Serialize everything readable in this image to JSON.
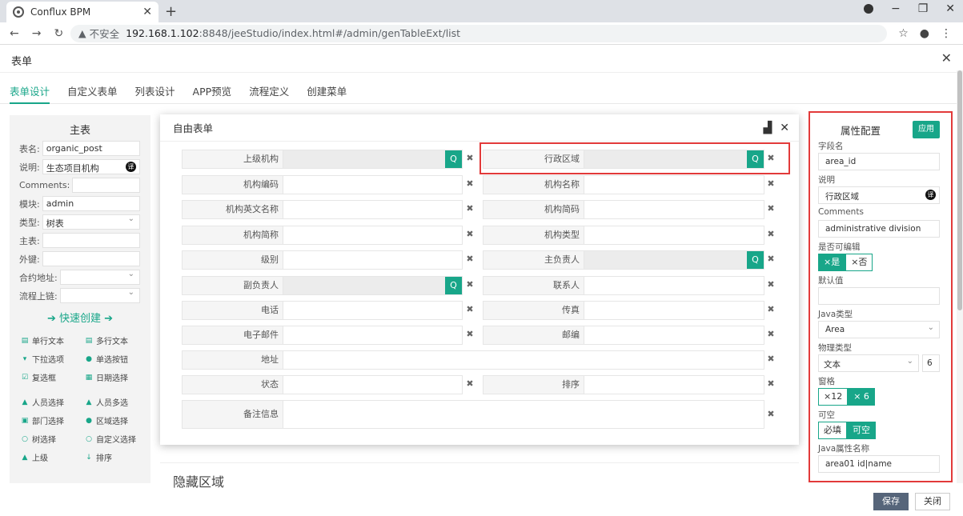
{
  "browser": {
    "tab_title": "Conflux BPM",
    "insecure_label": "不安全",
    "url_host": "192.168.1.102",
    "url_path": ":8848/jeeStudio/index.html#/admin/genTableExt/list"
  },
  "app": {
    "title": "表单",
    "tabs": [
      "表单设计",
      "自定义表单",
      "列表设计",
      "APP预览",
      "流程定义",
      "创建菜单"
    ]
  },
  "left_panel": {
    "title": "主表",
    "fields": [
      {
        "label": "表名:",
        "value": "organic_post"
      },
      {
        "label": "说明:",
        "value": "生态项目机构",
        "badge": "译"
      },
      {
        "label": "Comments:",
        "value": ""
      },
      {
        "label": "模块:",
        "value": "admin"
      },
      {
        "label": "类型:",
        "value": "树表",
        "select": true
      },
      {
        "label": "主表:",
        "value": ""
      },
      {
        "label": "外键:",
        "value": ""
      },
      {
        "label": "合约地址:",
        "value": "",
        "select": true
      },
      {
        "label": "流程上链:",
        "value": "",
        "select": true
      }
    ],
    "quick_create": "快速创建",
    "components": [
      {
        "icon": "▤",
        "name": "text-icon",
        "label": "单行文本"
      },
      {
        "icon": "▤",
        "name": "textarea-icon",
        "label": "多行文本"
      },
      {
        "icon": "▾",
        "name": "dropdown-icon",
        "label": "下拉选项"
      },
      {
        "icon": "●",
        "name": "radio-icon",
        "label": "单选按钮"
      },
      {
        "icon": "☑",
        "name": "checkbox-icon",
        "label": "复选框"
      },
      {
        "icon": "▦",
        "name": "calendar-icon",
        "label": "日期选择"
      },
      {
        "icon": "▲",
        "name": "user-icon",
        "label": "人员选择"
      },
      {
        "icon": "▲",
        "name": "users-icon",
        "label": "人员多选"
      },
      {
        "icon": "▣",
        "name": "sitemap-icon",
        "label": "部门选择"
      },
      {
        "icon": "●",
        "name": "map-pin-icon",
        "label": "区域选择"
      },
      {
        "icon": "○",
        "name": "search-icon",
        "label": "树选择"
      },
      {
        "icon": "○",
        "name": "search-icon",
        "label": "自定义选择"
      },
      {
        "icon": "▲",
        "name": "user-icon",
        "label": "上级"
      },
      {
        "icon": "↓",
        "name": "sort-icon",
        "label": "排序"
      }
    ]
  },
  "modal": {
    "title": "自由表单",
    "fields": {
      "f1": "上级机构",
      "f2": "行政区域",
      "f3": "机构编码",
      "f4": "机构名称",
      "f5": "机构英文名称",
      "f6": "机构简码",
      "f7": "机构简称",
      "f8": "机构类型",
      "f9": "级别",
      "f10": "主负责人",
      "f11": "副负责人",
      "f12": "联系人",
      "f13": "电话",
      "f14": "传真",
      "f15": "电子邮件",
      "f16": "邮编",
      "f17": "地址",
      "f18": "状态",
      "f19": "排序",
      "f20": "备注信息"
    },
    "search_icon": "Q",
    "delete_icon": "✖"
  },
  "hidden_area": {
    "title": "隐藏区域"
  },
  "right_panel": {
    "title": "属性配置",
    "apply": "应用",
    "field_name_label": "字段名",
    "field_name": "area_id",
    "desc_label": "说明",
    "desc": "行政区域",
    "badge": "译",
    "comments_label": "Comments",
    "comments": "administrative division",
    "editable_label": "是否可编辑",
    "editable_yes": "×是",
    "editable_no": "×否",
    "default_label": "默认值",
    "default_value": "",
    "java_type_label": "Java类型",
    "java_type": "Area",
    "phys_type_label": "物理类型",
    "phys_type": "文本",
    "phys_len": "6",
    "grid_label": "窗格",
    "grid_12": "×12",
    "grid_6": "× 6",
    "nullable_label": "可空",
    "required": "必填",
    "nullable": "可空",
    "java_attr_label": "Java属性名称",
    "java_attr": "area01 id|name"
  },
  "footer": {
    "save": "保存",
    "close": "关闭"
  }
}
